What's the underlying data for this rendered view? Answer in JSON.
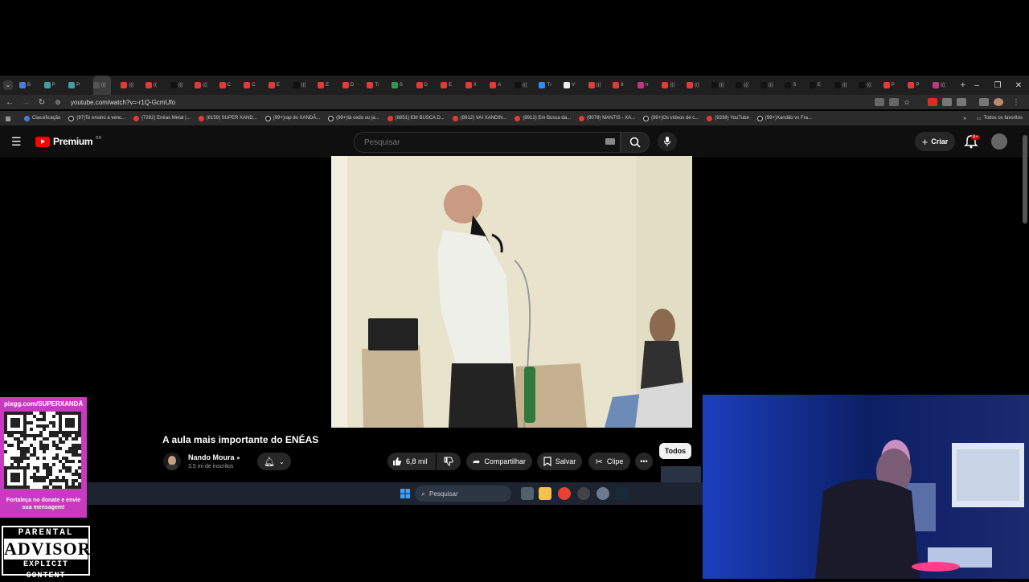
{
  "browser": {
    "tab_labels": [
      "B",
      "P",
      "P",
      "(((",
      "(((",
      "((",
      "(((",
      "(((",
      "C",
      "C",
      "E",
      "(((",
      "E",
      "D",
      "Tı",
      "S",
      "D",
      "E",
      "X",
      "A",
      "(((",
      "Tı",
      "V",
      "(((",
      "8",
      "Ir",
      "(((",
      "(((",
      "(((",
      "(((",
      "(((",
      "S",
      "E",
      "(((",
      "(((",
      "P",
      "P",
      "((("
    ],
    "url": "youtube.com/watch?v=-r1Q-GcmUfo",
    "bookmarks": [
      {
        "label": "Classificação",
        "icon": "globe"
      },
      {
        "label": "(97)Te ensino a venc...",
        "icon": "tiktok"
      },
      {
        "label": "(7292) Enéas Metal |...",
        "icon": "youtube"
      },
      {
        "label": "(8159) SUPER XAND...",
        "icon": "youtube"
      },
      {
        "label": "(99+)rap do XANDÃ...",
        "icon": "tiktok"
      },
      {
        "label": "(99+)tá cedo ou já...",
        "icon": "tiktok"
      },
      {
        "label": "(8851) EM BUSCA D...",
        "icon": "youtube"
      },
      {
        "label": "(8912) VAI XANDIN...",
        "icon": "youtube"
      },
      {
        "label": "(8912) Em Busca da...",
        "icon": "youtube"
      },
      {
        "label": "(9078) MANTIS - XA...",
        "icon": "youtube"
      },
      {
        "label": "(99+)Os vídeos de c...",
        "icon": "tiktok"
      },
      {
        "label": "(9338) YouTube",
        "icon": "youtube"
      },
      {
        "label": "(99+)Xandão vs Fra...",
        "icon": "tiktok"
      }
    ],
    "bookmarks_folder": "Todos os favoritos"
  },
  "youtube": {
    "logo_text": "Premium",
    "logo_region": "BR",
    "search_placeholder": "Pesquisar",
    "create_label": "Criar",
    "notif_badge": "9+",
    "video_title": "A aula mais importante do ENÉAS",
    "channel_name": "Nando Moura",
    "subscribers": "3,5 mi de inscritos",
    "like_count": "6,8 mil",
    "share_label": "Compartilhar",
    "save_label": "Salvar",
    "clip_label": "Clipe",
    "chip_all": "Todos"
  },
  "taskbar": {
    "search_placeholder": "Pesquisar"
  },
  "overlay": {
    "donate_url": "pixgg.com/SUPERXANDÃ",
    "donate_caption": "Fortaleça no donate e envie sua mensagem!",
    "advisory_top": "PARENTAL",
    "advisory_mid": "ADVISORY",
    "advisory_bottom": "EXPLICIT CONTENT"
  },
  "colors": {
    "youtube_red": "#ff0000",
    "donate_panel": "#c83bc0",
    "webcam_blue": "#0b1b4d"
  }
}
